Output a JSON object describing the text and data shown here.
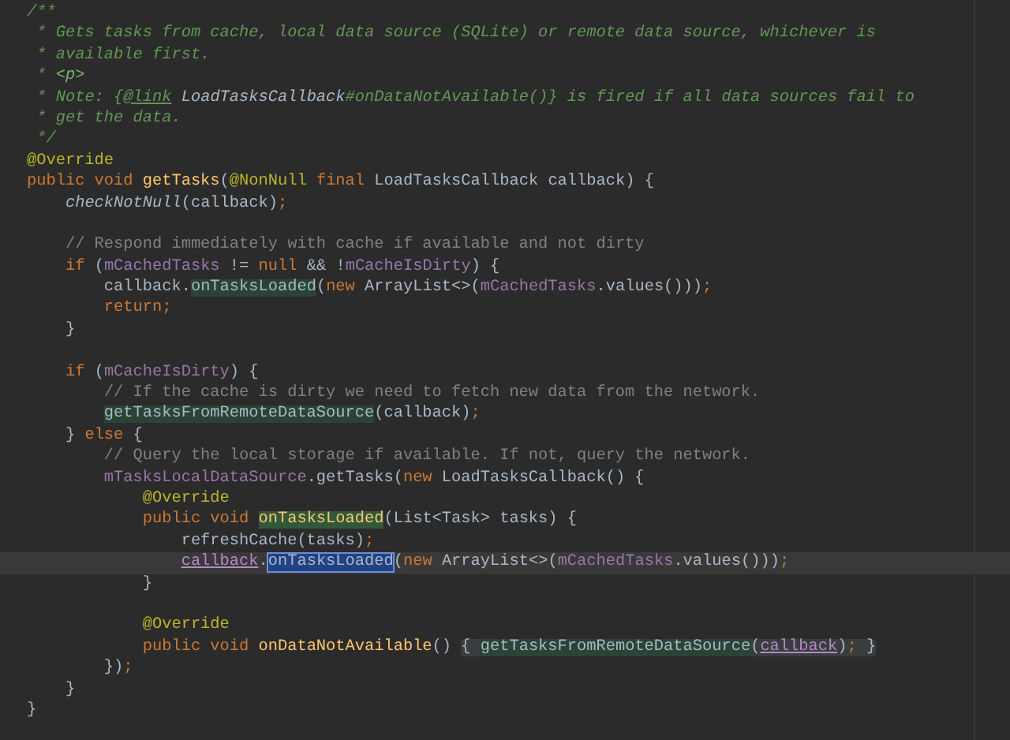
{
  "editor": {
    "lines": [
      {
        "current": false,
        "tokens": [
          {
            "t": "/**",
            "kind": "doc"
          }
        ]
      },
      {
        "current": false,
        "tokens": [
          {
            "t": " * Gets tasks from cache, local data source (SQLite) or remote data source, whichever is",
            "kind": "doc"
          }
        ]
      },
      {
        "current": false,
        "tokens": [
          {
            "t": " * available first.",
            "kind": "doc"
          }
        ]
      },
      {
        "current": false,
        "tokens": [
          {
            "t": " * ",
            "kind": "doc"
          },
          {
            "t": "<p>",
            "kind": "doctag"
          }
        ]
      },
      {
        "current": false,
        "tokens": [
          {
            "t": " * Note: {",
            "kind": "doc"
          },
          {
            "t": "@link",
            "kind": "doclink"
          },
          {
            "t": " LoadTasksCallback",
            "kind": "docref"
          },
          {
            "t": "#onDataNotAvailable()} is fired if all data sources fail to",
            "kind": "doc"
          }
        ]
      },
      {
        "current": false,
        "tokens": [
          {
            "t": " * get the data.",
            "kind": "doc"
          }
        ]
      },
      {
        "current": false,
        "tokens": [
          {
            "t": " */",
            "kind": "doc"
          }
        ]
      },
      {
        "current": false,
        "tokens": [
          {
            "t": "@Override",
            "kind": "ann"
          }
        ]
      },
      {
        "current": false,
        "tokens": [
          {
            "t": "public void ",
            "kind": "kw"
          },
          {
            "t": "getTasks",
            "kind": "decl"
          },
          {
            "t": "(",
            "kind": "plain"
          },
          {
            "t": "@NonNull ",
            "kind": "ann"
          },
          {
            "t": "final",
            "kind": "kw"
          },
          {
            "t": " LoadTasksCallback callback) {",
            "kind": "plain"
          }
        ]
      },
      {
        "current": false,
        "tokens": [
          {
            "t": "    checkNotNull",
            "kind": "static"
          },
          {
            "t": "(callback)",
            "kind": "plain"
          },
          {
            "t": ";",
            "kind": "kw"
          }
        ]
      },
      {
        "current": false
      },
      {
        "current": false,
        "tokens": [
          {
            "t": "    // Respond immediately with cache if available and not dirty",
            "kind": "lcomment"
          }
        ]
      },
      {
        "current": false,
        "tokens": [
          {
            "t": "    if",
            "kind": "kw"
          },
          {
            "t": " (",
            "kind": "plain"
          },
          {
            "t": "mCachedTasks",
            "kind": "field"
          },
          {
            "t": " != ",
            "kind": "plain"
          },
          {
            "t": "null",
            "kind": "kw"
          },
          {
            "t": " && !",
            "kind": "plain"
          },
          {
            "t": "mCacheIsDirty",
            "kind": "field"
          },
          {
            "t": ") {",
            "kind": "plain"
          }
        ]
      },
      {
        "current": false,
        "tokens": [
          {
            "t": "        callback.",
            "kind": "plain"
          },
          {
            "t": "onTasksLoaded",
            "kind": "plain",
            "highlighted": true
          },
          {
            "t": "(",
            "kind": "plain"
          },
          {
            "t": "new",
            "kind": "kw"
          },
          {
            "t": " ArrayList<>(",
            "kind": "plain"
          },
          {
            "t": "mCachedTasks",
            "kind": "field"
          },
          {
            "t": ".values()))",
            "kind": "plain"
          },
          {
            "t": ";",
            "kind": "kw"
          }
        ]
      },
      {
        "current": false,
        "tokens": [
          {
            "t": "        return;",
            "kind": "kw"
          }
        ]
      },
      {
        "current": false,
        "tokens": [
          {
            "t": "    }",
            "kind": "plain"
          }
        ]
      },
      {
        "current": false
      },
      {
        "current": false,
        "tokens": [
          {
            "t": "    if",
            "kind": "kw"
          },
          {
            "t": " (",
            "kind": "plain"
          },
          {
            "t": "mCacheIsDirty",
            "kind": "field"
          },
          {
            "t": ") {",
            "kind": "plain"
          }
        ]
      },
      {
        "current": false,
        "tokens": [
          {
            "t": "        // If the cache is dirty we need to fetch new data from the network.",
            "kind": "lcomment"
          }
        ]
      },
      {
        "current": false,
        "tokens": [
          {
            "t": "        getTasksFromRemoteDataSource",
            "kind": "plain",
            "highlighted": true
          },
          {
            "t": "(callback)",
            "kind": "plain"
          },
          {
            "t": ";",
            "kind": "kw"
          }
        ]
      },
      {
        "current": false,
        "tokens": [
          {
            "t": "    } ",
            "kind": "plain"
          },
          {
            "t": "else",
            "kind": "kw"
          },
          {
            "t": " {",
            "kind": "plain"
          }
        ]
      },
      {
        "current": false,
        "tokens": [
          {
            "t": "        // Query the local storage if available. If not, query the network.",
            "kind": "lcomment"
          }
        ]
      },
      {
        "current": false,
        "tokens": [
          {
            "t": "        mTasksLocalDataSource",
            "kind": "field"
          },
          {
            "t": ".getTasks(",
            "kind": "plain"
          },
          {
            "t": "new",
            "kind": "kw"
          },
          {
            "t": " LoadTasksCallback() {",
            "kind": "plain"
          }
        ]
      },
      {
        "current": false,
        "tokens": [
          {
            "t": "            @Override",
            "kind": "ann"
          }
        ]
      },
      {
        "current": false,
        "tokens": [
          {
            "t": "            public void ",
            "kind": "kw"
          },
          {
            "t": "onTasksLoaded",
            "kind": "decl",
            "highlighted": true
          },
          {
            "t": "(List<Task> tasks) {",
            "kind": "plain"
          }
        ]
      },
      {
        "current": false,
        "tokens": [
          {
            "t": "                refreshCache(tasks)",
            "kind": "plain"
          },
          {
            "t": ";",
            "kind": "kw"
          }
        ]
      },
      {
        "current": true,
        "tokens": [
          {
            "t": "                callback",
            "kind": "captured"
          },
          {
            "t": ".",
            "kind": "plain"
          },
          {
            "t": "onTasksLoaded",
            "kind": "plain",
            "selected": true
          },
          {
            "t": "(",
            "kind": "plain"
          },
          {
            "t": "new",
            "kind": "kw"
          },
          {
            "t": " ArrayList<>(",
            "kind": "plain"
          },
          {
            "t": "mCachedTasks",
            "kind": "field"
          },
          {
            "t": ".values()))",
            "kind": "plain"
          },
          {
            "t": ";",
            "kind": "kw"
          }
        ]
      },
      {
        "current": false,
        "tokens": [
          {
            "t": "            }",
            "kind": "plain"
          }
        ]
      },
      {
        "current": false
      },
      {
        "current": false,
        "tokens": [
          {
            "t": "            @Override",
            "kind": "ann"
          }
        ]
      },
      {
        "current": false,
        "tokens": [
          {
            "t": "            public void ",
            "kind": "kw"
          },
          {
            "t": "onDataNotAvailable",
            "kind": "decl"
          },
          {
            "t": "() ",
            "kind": "plain"
          }
        ],
        "folded": [
          {
            "t": "{ ",
            "kind": "plain"
          },
          {
            "t": "getTasksFromRemoteDataSource",
            "kind": "plain",
            "highlighted": true
          },
          {
            "t": "(",
            "kind": "plain"
          },
          {
            "t": "callback",
            "kind": "captured"
          },
          {
            "t": ")",
            "kind": "plain"
          },
          {
            "t": ";",
            "kind": "kw"
          },
          {
            "t": " }",
            "kind": "plain"
          }
        ]
      },
      {
        "current": false,
        "tokens": [
          {
            "t": "        })",
            "kind": "plain"
          },
          {
            "t": ";",
            "kind": "kw"
          }
        ]
      },
      {
        "current": false,
        "tokens": [
          {
            "t": "    }",
            "kind": "plain"
          }
        ]
      },
      {
        "current": false,
        "tokens": [
          {
            "t": "}",
            "kind": "plain"
          }
        ]
      }
    ]
  }
}
